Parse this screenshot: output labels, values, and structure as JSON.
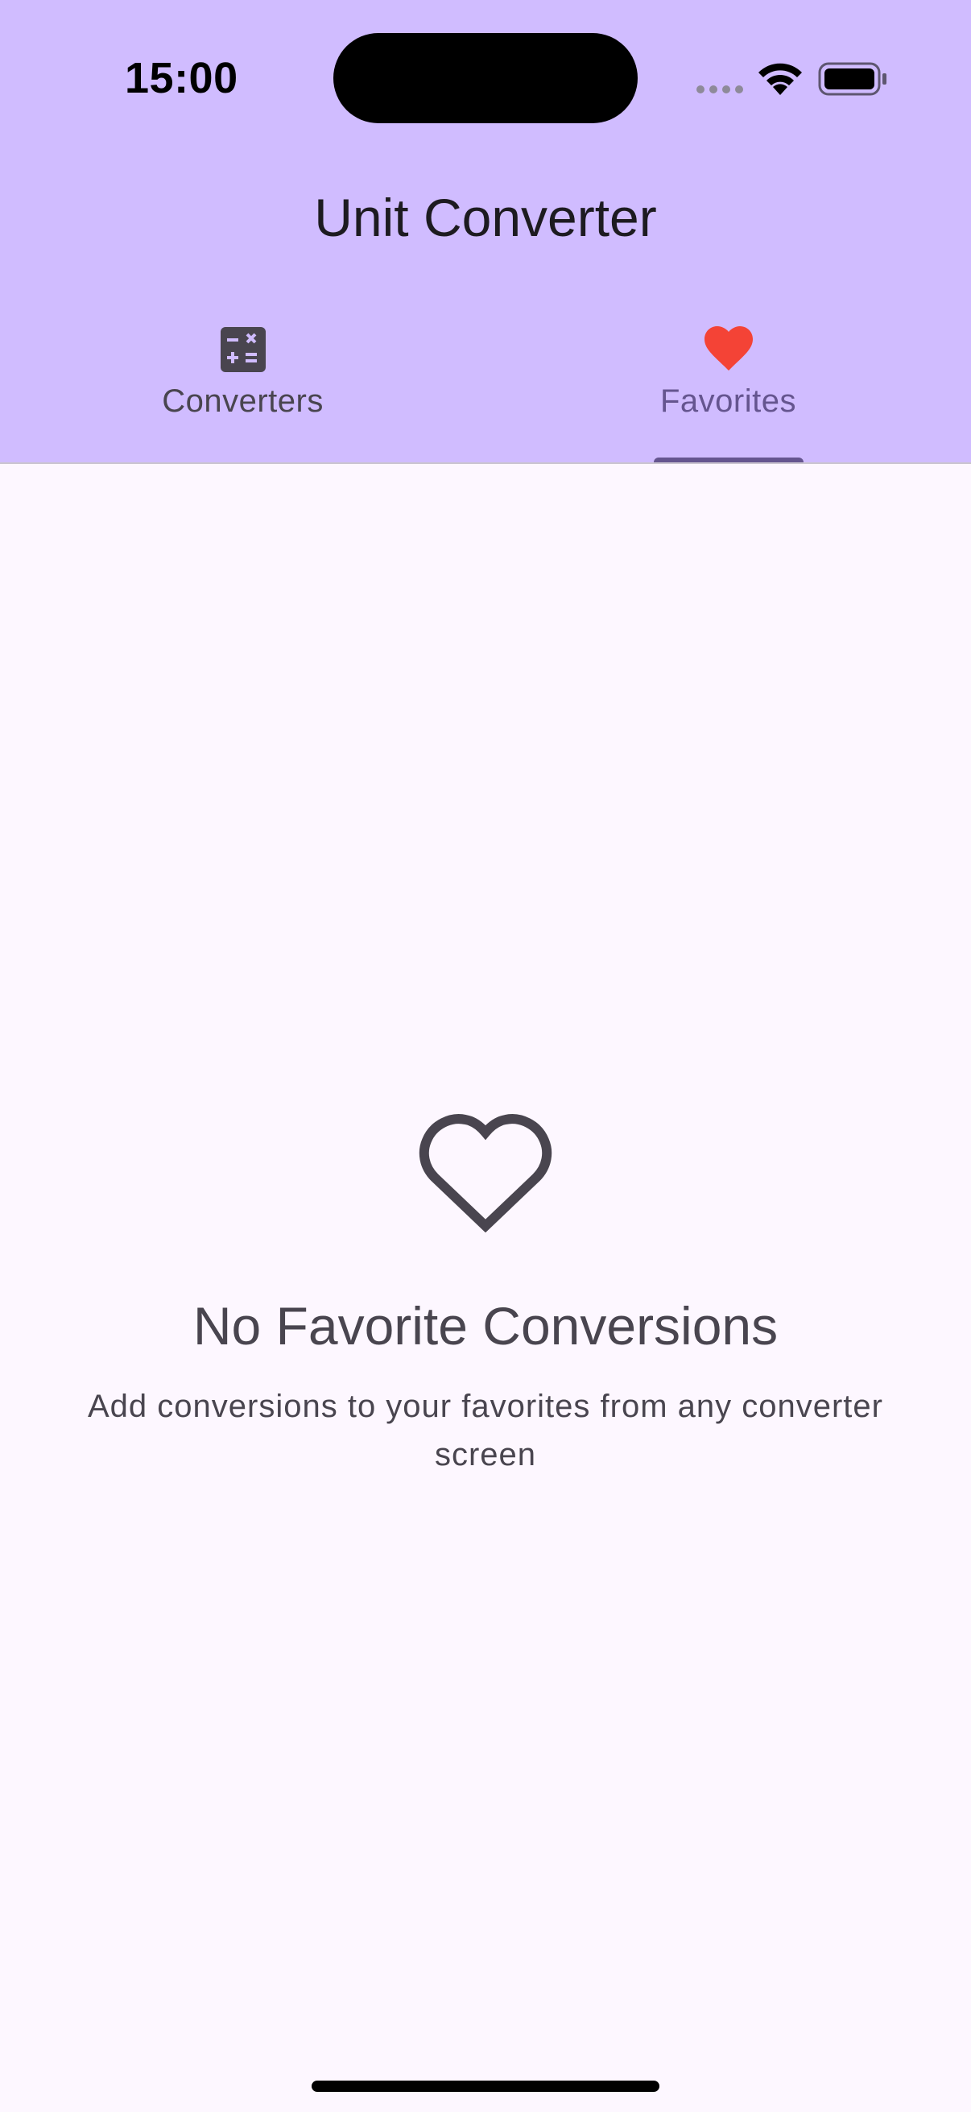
{
  "status_bar": {
    "time": "15:00",
    "wifi_icon": "wifi-icon",
    "battery_icon": "battery-icon"
  },
  "app_bar": {
    "title": "Unit Converter",
    "background_color": "#D0BCFF"
  },
  "tabs": [
    {
      "label": "Converters",
      "icon": "calculator-icon",
      "selected": false
    },
    {
      "label": "Favorites",
      "icon": "heart-icon",
      "selected": true,
      "icon_color": "#F44336"
    }
  ],
  "empty_state": {
    "icon": "heart-outline-icon",
    "title": "No Favorite Conversions",
    "subtitle": "Add conversions to your favorites from any converter screen"
  },
  "colors": {
    "accent": "#65558F",
    "background": "#FDF7FF",
    "text_secondary": "#49454F"
  }
}
